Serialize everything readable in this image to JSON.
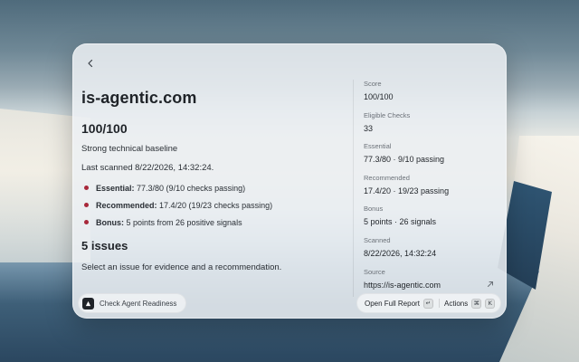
{
  "panel": {
    "domain": "is-agentic.com",
    "score_heading": "100/100",
    "summary": "Strong technical baseline",
    "last_scanned": "Last scanned 8/22/2026, 14:32:24.",
    "bullets": [
      {
        "label": "Essential:",
        "text": " 77.3/80 (9/10 checks passing)"
      },
      {
        "label": "Recommended:",
        "text": " 17.4/20 (19/23 checks passing)"
      },
      {
        "label": "Bonus:",
        "text": " 5 points from 26 positive signals"
      }
    ],
    "issues_heading": "5 issues",
    "issues_hint": "Select an issue for evidence and a recommendation."
  },
  "details": [
    {
      "label": "Score",
      "value": "100/100"
    },
    {
      "label": "Eligible Checks",
      "value": "33"
    },
    {
      "label": "Essential",
      "value": "77.3/80 · 9/10 passing"
    },
    {
      "label": "Recommended",
      "value": "17.4/20 · 19/23 passing"
    },
    {
      "label": "Bonus",
      "value": "5 points · 26 signals"
    },
    {
      "label": "Scanned",
      "value": "8/22/2026, 14:32:24"
    },
    {
      "label": "Source",
      "value": "https://is-agentic.com"
    }
  ],
  "footer": {
    "command_label": "Check Agent Readiness",
    "primary_action": "Open Full Report",
    "primary_key": "↵",
    "actions_label": "Actions",
    "actions_keys": [
      "⌘",
      "K"
    ]
  },
  "icons": {
    "back": "chevron-left-icon",
    "external": "arrow-up-right-icon",
    "logo": "triangle-logo-icon"
  },
  "colors": {
    "bullet": "#a8283a",
    "text": "#1f2328"
  }
}
